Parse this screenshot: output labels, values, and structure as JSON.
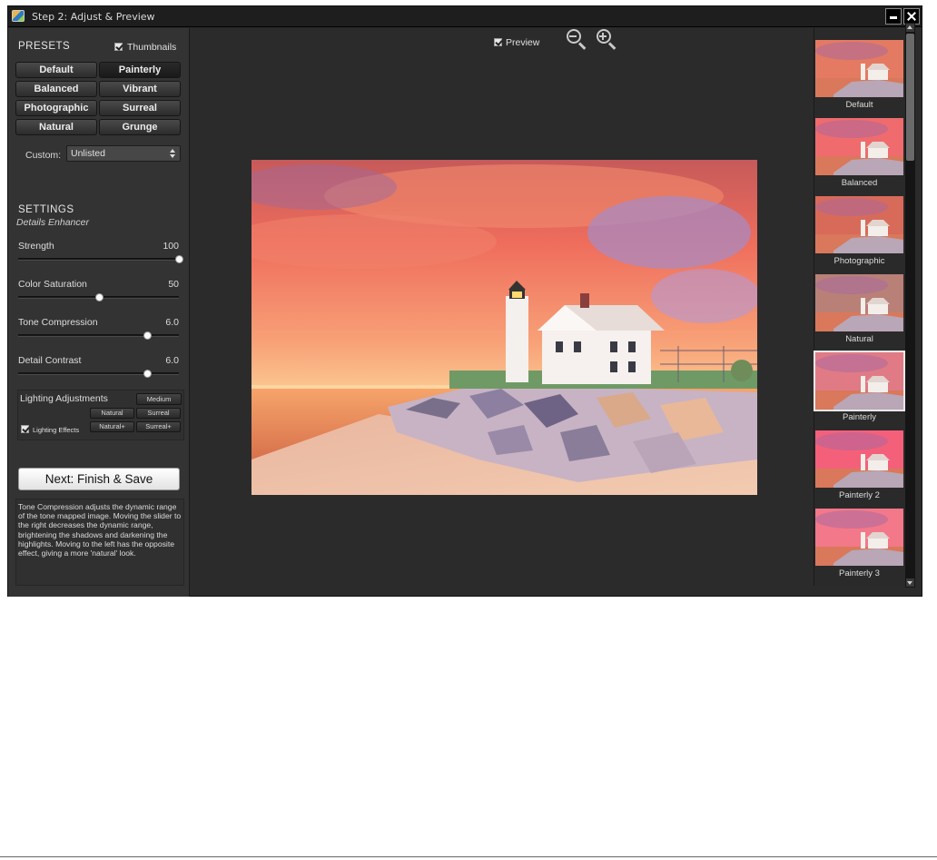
{
  "window": {
    "title": "Step 2: Adjust & Preview"
  },
  "presets": {
    "title": "PRESETS",
    "thumbnails_label": "Thumbnails",
    "buttons": [
      "Default",
      "Painterly",
      "Balanced",
      "Vibrant",
      "Photographic",
      "Surreal",
      "Natural",
      "Grunge"
    ],
    "active": "Painterly",
    "custom_label": "Custom:",
    "custom_value": "Unlisted"
  },
  "settings": {
    "title": "SETTINGS",
    "subtitle": "Details Enhancer",
    "sliders": [
      {
        "label": "Strength",
        "value": "100",
        "fraction": 1.0
      },
      {
        "label": "Color Saturation",
        "value": "50",
        "fraction": 0.5
      },
      {
        "label": "Tone Compression",
        "value": "6.0",
        "fraction": 0.8
      },
      {
        "label": "Detail Contrast",
        "value": "6.0",
        "fraction": 0.8
      }
    ],
    "lighting": {
      "title": "Lighting Adjustments",
      "medium": "Medium",
      "natural": "Natural",
      "surreal": "Surreal",
      "natural_plus": "Natural+",
      "surreal_plus": "Surreal+",
      "effects_label": "Lighting Effects"
    }
  },
  "next_button": "Next: Finish & Save",
  "help_text": "Tone Compression adjusts the dynamic range of the tone mapped image. Moving the slider to the right decreases the dynamic range, brightening the shadows and darkening the highlights. Moving to the left has the opposite effect, giving a more 'natural' look.",
  "preview": {
    "label": "Preview"
  },
  "thumbnails": [
    "Default",
    "Balanced",
    "Photographic",
    "Natural",
    "Painterly",
    "Painterly 2",
    "Painterly 3"
  ],
  "selected_thumbnail": "Painterly",
  "colors": {
    "panel": "#333333",
    "background": "#2b2b2b",
    "titlebar": "#1e1e1e",
    "text": "#e0e0e0"
  },
  "icons": [
    "app-icon",
    "minimize-icon",
    "close-icon",
    "zoom-out-icon",
    "zoom-in-icon",
    "checkbox-icon",
    "select-arrows-icon"
  ]
}
